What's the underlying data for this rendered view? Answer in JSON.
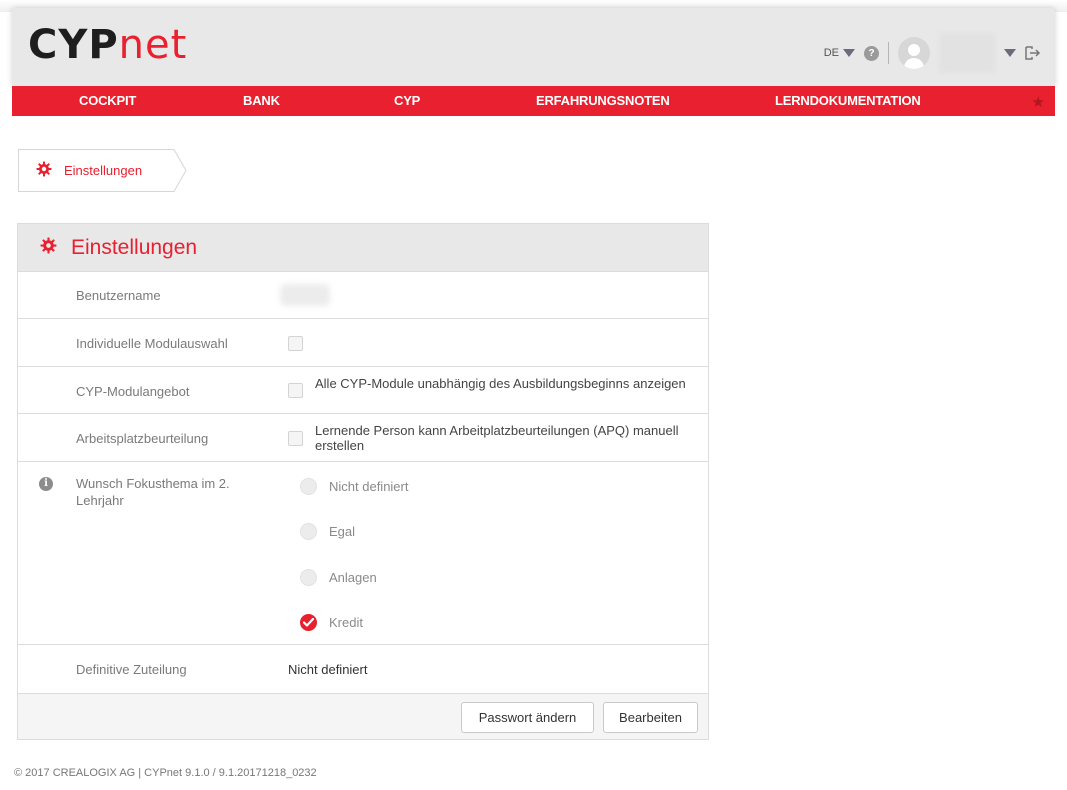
{
  "app": {
    "logo_part1": "CYP",
    "logo_part2": "net"
  },
  "header": {
    "language": "DE",
    "help_icon": "question-circle-icon",
    "user_icon": "user-avatar-icon",
    "logout_icon": "logout-icon"
  },
  "nav": {
    "items": [
      {
        "label": "COCKPIT"
      },
      {
        "label": "BANK"
      },
      {
        "label": "CYP"
      },
      {
        "label": "ERFAHRUNGSNOTEN"
      },
      {
        "label": "LERNDOKUMENTATION"
      }
    ],
    "favorite_icon": "star-icon"
  },
  "breadcrumb": {
    "label": "Einstellungen",
    "icon": "gear-icon"
  },
  "panel": {
    "title": "Einstellungen",
    "icon": "gear-icon",
    "rows": {
      "username": {
        "label": "Benutzername"
      },
      "module_selection": {
        "label": "Individuelle Modulauswahl"
      },
      "module_offer": {
        "label": "CYP-Modulangebot",
        "text": "Alle CYP-Module unabhängig des Ausbildungsbeginns anzeigen"
      },
      "workplace_assessment": {
        "label": "Arbeitsplatzbeurteilung",
        "text": "Lernende Person kann Arbeitplatzbeurteilungen (APQ) manuell erstellen"
      },
      "focus_topic": {
        "label": "Wunsch Fokusthema im 2. Lehrjahr",
        "options": [
          {
            "label": "Nicht definiert",
            "checked": false
          },
          {
            "label": "Egal",
            "checked": false
          },
          {
            "label": "Anlagen",
            "checked": false
          },
          {
            "label": "Kredit",
            "checked": true
          }
        ]
      },
      "final_assignment": {
        "label": "Definitive Zuteilung",
        "value": "Nicht definiert"
      }
    },
    "buttons": {
      "change_password": "Passwort ändern",
      "edit": "Bearbeiten"
    }
  },
  "footer": {
    "text": "© 2017 CREALOGIX AG  |  CYPnet 9.1.0 / 9.1.20171218_0232"
  },
  "colors": {
    "brand_red": "#e8202f",
    "header_gray": "#e8e8e8"
  }
}
